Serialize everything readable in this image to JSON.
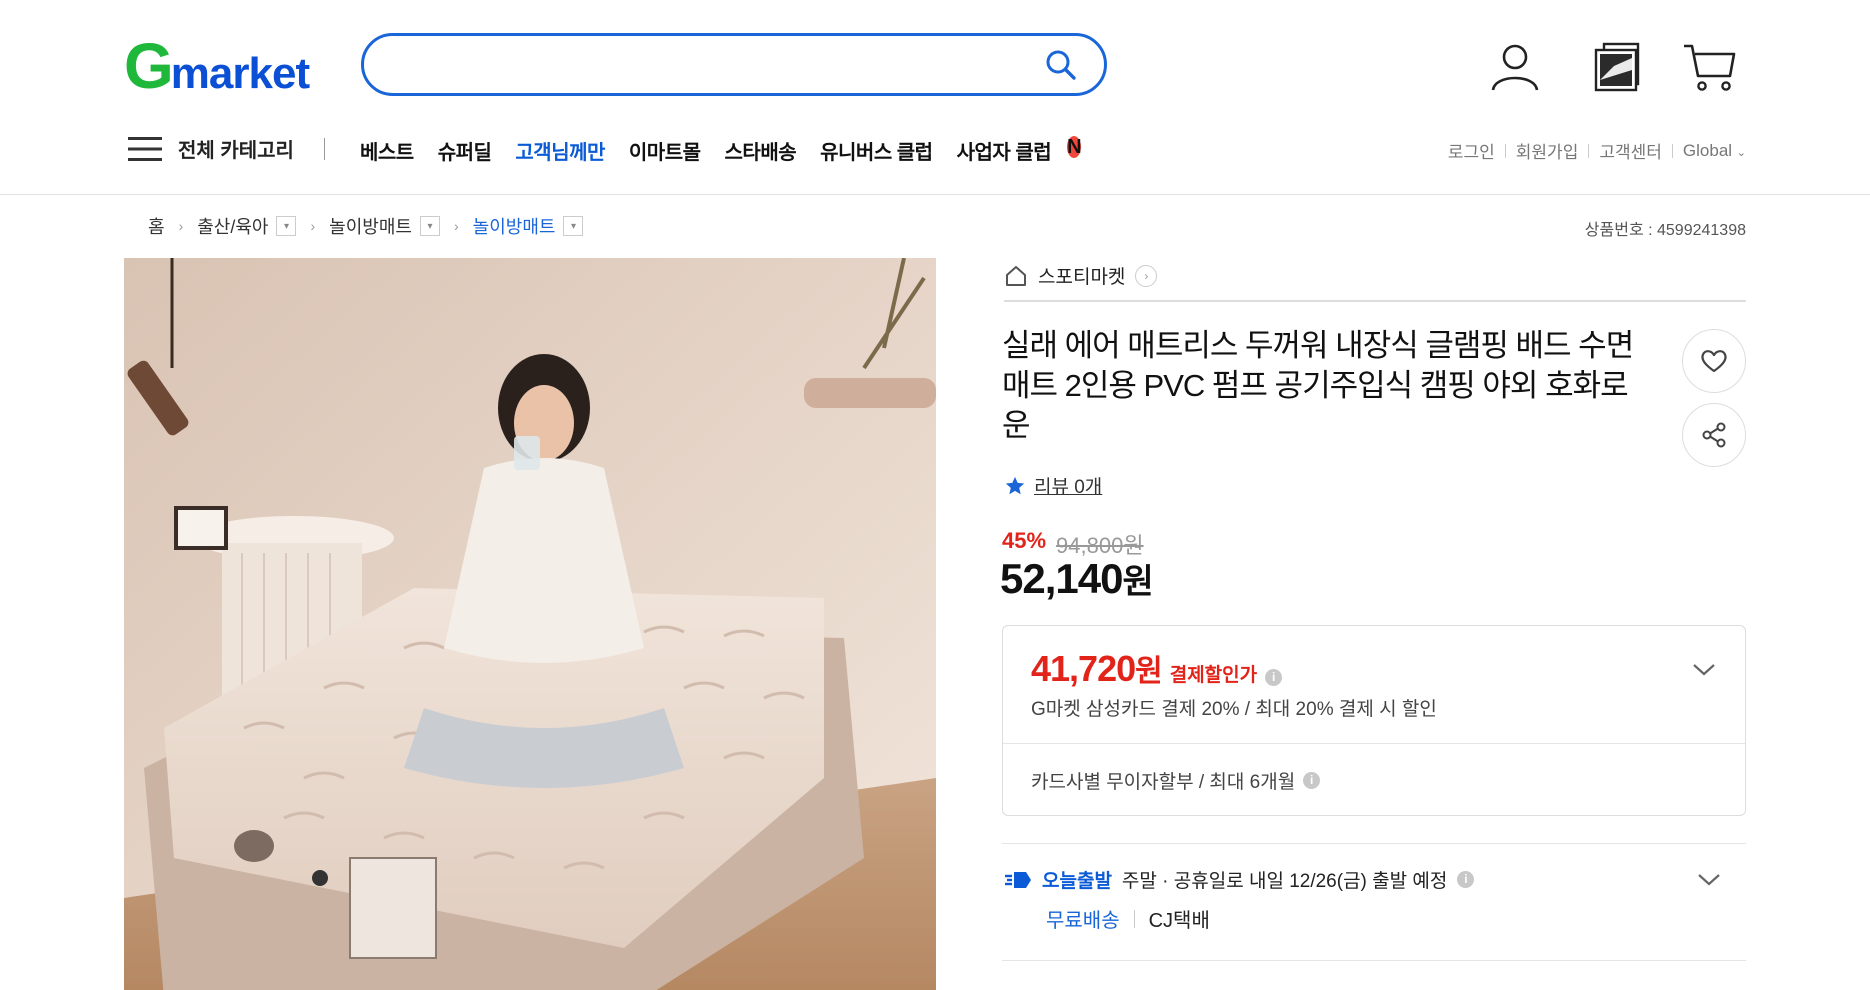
{
  "header": {
    "logo_g": "G",
    "logo_rest": "market",
    "search": {
      "value": "",
      "placeholder": ""
    },
    "icons": [
      "user-icon",
      "recent-items-icon",
      "cart-icon"
    ]
  },
  "nav": {
    "all_categories": "전체 카테고리",
    "items": [
      {
        "label": "베스트"
      },
      {
        "label": "슈퍼딜"
      },
      {
        "label": "고객님께만"
      },
      {
        "label": "이마트몰"
      },
      {
        "label": "스타배송"
      },
      {
        "label": "유니버스 클럽"
      },
      {
        "label": "사업자 클럽",
        "badge": "N"
      }
    ],
    "util": [
      "로그인",
      "회원가입",
      "고객센터",
      "Global"
    ]
  },
  "breadcrumb": {
    "home": "홈",
    "items": [
      "출산/육아",
      "놀이방매트",
      "놀이방매트"
    ]
  },
  "product_id": "상품번호 : 4599241398",
  "shop_name": "스포티마켓",
  "title": "실래 에어 매트리스 두꺼워 내장식 글램핑 배드 수면 매트 2인용 PVC 펌프 공기주입식 캠핑 야외 호화로운",
  "review": "리뷰 0개",
  "discount_rate": "45%",
  "original_price": "94,800원",
  "price": {
    "number": "52,140",
    "unit": "원"
  },
  "card_benefit": {
    "price_number": "41,720",
    "price_unit": "원",
    "label": "결제할인가",
    "desc": "G마켓 삼성카드 결제 20% / 최대 20% 결제 시 할인",
    "installment": "카드사별 무이자할부 / 최대 6개월"
  },
  "shipping": {
    "today_label": "오늘출발",
    "schedule": "주말 · 공휴일로 내일 12/26(금) 출발 예정",
    "free": "무료배송",
    "carrier": "CJ택배"
  },
  "colors": {
    "brand_green": "#1fb83b",
    "brand_blue": "#0a4fd4",
    "accent_blue": "#1a66d8",
    "sale_red": "#e2231a"
  }
}
